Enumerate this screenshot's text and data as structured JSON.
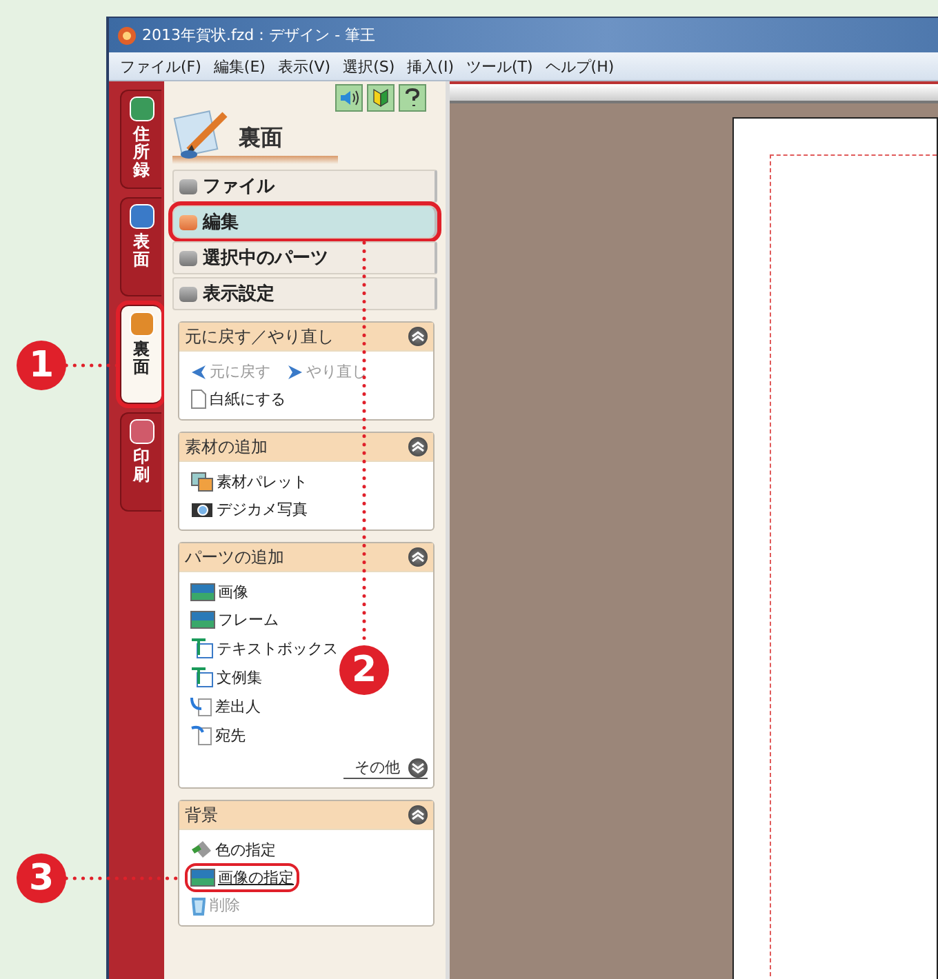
{
  "window": {
    "title": "2013年賀状.fzd：デザイン - 筆王"
  },
  "menu": [
    "ファイル(F)",
    "編集(E)",
    "表示(V)",
    "選択(S)",
    "挿入(I)",
    "ツール(T)",
    "ヘルプ(H)"
  ],
  "side_tabs": [
    {
      "label": "住所録",
      "selected": false,
      "highlighted": false
    },
    {
      "label": "表面",
      "selected": false,
      "highlighted": false
    },
    {
      "label": "裏面",
      "selected": true,
      "highlighted": true
    },
    {
      "label": "印刷",
      "selected": false,
      "highlighted": false
    }
  ],
  "panel": {
    "title": "裏面",
    "modes": [
      {
        "label": "ファイル",
        "selected": false,
        "highlighted": false
      },
      {
        "label": "編集",
        "selected": true,
        "highlighted": true
      },
      {
        "label": "選択中のパーツ",
        "selected": false,
        "highlighted": false
      },
      {
        "label": "表示設定",
        "selected": false,
        "highlighted": false
      }
    ],
    "sections": [
      {
        "title": "元に戻す／やり直し",
        "expanded": true,
        "rows": [
          [
            {
              "kind": "undo",
              "label": "元に戻す",
              "disabled": true,
              "highlighted": false
            },
            {
              "kind": "redo",
              "label": "やり直し",
              "disabled": true,
              "highlighted": false
            }
          ],
          [
            {
              "kind": "page",
              "label": "白紙にする",
              "disabled": false,
              "highlighted": false
            }
          ]
        ]
      },
      {
        "title": "素材の追加",
        "expanded": true,
        "rows": [
          [
            {
              "kind": "palette",
              "label": "素材パレット",
              "disabled": false,
              "highlighted": false
            }
          ],
          [
            {
              "kind": "camera",
              "label": "デジカメ写真",
              "disabled": false,
              "highlighted": false
            }
          ]
        ]
      },
      {
        "title": "パーツの追加",
        "expanded": true,
        "more": "その他",
        "rows": [
          [
            {
              "kind": "image",
              "label": "画像",
              "disabled": false,
              "highlighted": false
            }
          ],
          [
            {
              "kind": "image",
              "label": "フレーム",
              "disabled": false,
              "highlighted": false
            }
          ],
          [
            {
              "kind": "text",
              "label": "テキストボックス",
              "disabled": false,
              "highlighted": false
            }
          ],
          [
            {
              "kind": "text",
              "label": "文例集",
              "disabled": false,
              "highlighted": false
            }
          ],
          [
            {
              "kind": "sender",
              "label": "差出人",
              "disabled": false,
              "highlighted": false
            }
          ],
          [
            {
              "kind": "address",
              "label": "宛先",
              "disabled": false,
              "highlighted": false
            }
          ]
        ]
      },
      {
        "title": "背景",
        "expanded": true,
        "rows": [
          [
            {
              "kind": "paint",
              "label": "色の指定",
              "disabled": false,
              "highlighted": false
            }
          ],
          [
            {
              "kind": "image",
              "label": "画像の指定",
              "disabled": false,
              "highlighted": true
            }
          ],
          [
            {
              "kind": "delete",
              "label": "削除",
              "disabled": true,
              "highlighted": false
            }
          ]
        ]
      }
    ]
  },
  "callouts": [
    {
      "label": "1"
    },
    {
      "label": "2"
    },
    {
      "label": "3"
    }
  ]
}
